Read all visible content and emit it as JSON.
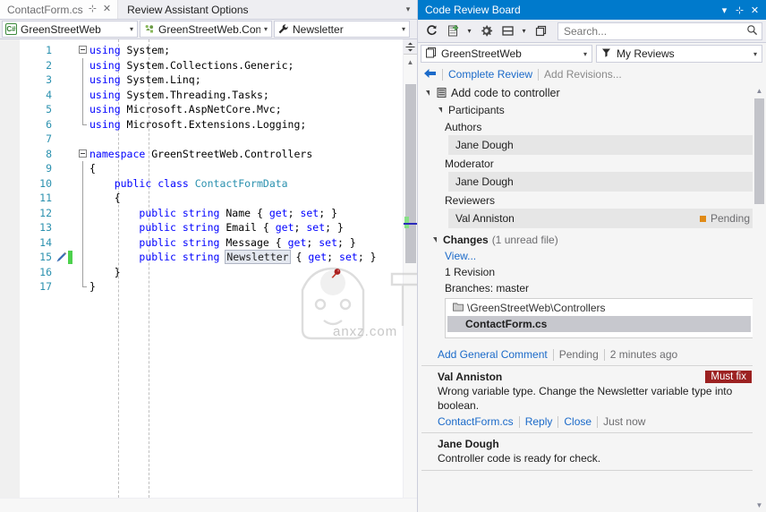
{
  "editor": {
    "tabs": [
      {
        "label": "ContactForm.cs",
        "active": true,
        "pin": "⊹",
        "close": "✕"
      },
      {
        "label": "Review Assistant Options",
        "active": false
      }
    ],
    "tab_overflow_icon": "chevron-down-icon",
    "nav": {
      "project": "GreenStreetWeb",
      "project_icon": "csharp-file-icon",
      "type": "GreenStreetWeb.Contro",
      "type_icon": "namespace-icon",
      "member": "Newsletter",
      "member_icon": "wrench-icon",
      "arrow": "▾"
    },
    "line_numbers": [
      "1",
      "2",
      "3",
      "4",
      "5",
      "6",
      "7",
      "8",
      "9",
      "10",
      "11",
      "12",
      "13",
      "14",
      "15",
      "16",
      "17"
    ],
    "code": [
      {
        "n": 1,
        "tokens": [
          {
            "t": "using",
            "c": "kw"
          },
          {
            "t": " System;",
            "c": "pn"
          }
        ]
      },
      {
        "n": 2,
        "tokens": [
          {
            "t": "using",
            "c": "kw"
          },
          {
            "t": " System.Collections.Generic;",
            "c": "pn"
          }
        ]
      },
      {
        "n": 3,
        "tokens": [
          {
            "t": "using",
            "c": "kw"
          },
          {
            "t": " System.Linq;",
            "c": "pn"
          }
        ]
      },
      {
        "n": 4,
        "tokens": [
          {
            "t": "using",
            "c": "kw"
          },
          {
            "t": " System.Threading.Tasks;",
            "c": "pn"
          }
        ]
      },
      {
        "n": 5,
        "tokens": [
          {
            "t": "using",
            "c": "kw"
          },
          {
            "t": " Microsoft.AspNetCore.Mvc;",
            "c": "pn"
          }
        ]
      },
      {
        "n": 6,
        "tokens": [
          {
            "t": "using",
            "c": "kw"
          },
          {
            "t": " Microsoft.Extensions.Logging;",
            "c": "pn"
          }
        ]
      },
      {
        "n": 7,
        "tokens": []
      },
      {
        "n": 8,
        "tokens": [
          {
            "t": "namespace",
            "c": "kw"
          },
          {
            "t": " GreenStreetWeb.Controllers",
            "c": "pn"
          }
        ]
      },
      {
        "n": 9,
        "tokens": [
          {
            "t": "{",
            "c": "pn"
          }
        ]
      },
      {
        "n": 10,
        "tokens": [
          {
            "t": "    ",
            "c": "pn"
          },
          {
            "t": "public",
            "c": "kw"
          },
          {
            "t": " ",
            "c": "pn"
          },
          {
            "t": "class",
            "c": "kw"
          },
          {
            "t": " ",
            "c": "pn"
          },
          {
            "t": "ContactFormData",
            "c": "ty"
          }
        ]
      },
      {
        "n": 11,
        "tokens": [
          {
            "t": "    {",
            "c": "pn"
          }
        ]
      },
      {
        "n": 12,
        "tokens": [
          {
            "t": "        ",
            "c": "pn"
          },
          {
            "t": "public",
            "c": "kw"
          },
          {
            "t": " ",
            "c": "pn"
          },
          {
            "t": "string",
            "c": "kw"
          },
          {
            "t": " Name { ",
            "c": "pn"
          },
          {
            "t": "get",
            "c": "kw"
          },
          {
            "t": "; ",
            "c": "pn"
          },
          {
            "t": "set",
            "c": "kw"
          },
          {
            "t": "; }",
            "c": "pn"
          }
        ]
      },
      {
        "n": 13,
        "tokens": [
          {
            "t": "        ",
            "c": "pn"
          },
          {
            "t": "public",
            "c": "kw"
          },
          {
            "t": " ",
            "c": "pn"
          },
          {
            "t": "string",
            "c": "kw"
          },
          {
            "t": " Email { ",
            "c": "pn"
          },
          {
            "t": "get",
            "c": "kw"
          },
          {
            "t": "; ",
            "c": "pn"
          },
          {
            "t": "set",
            "c": "kw"
          },
          {
            "t": "; }",
            "c": "pn"
          }
        ]
      },
      {
        "n": 14,
        "tokens": [
          {
            "t": "        ",
            "c": "pn"
          },
          {
            "t": "public",
            "c": "kw"
          },
          {
            "t": " ",
            "c": "pn"
          },
          {
            "t": "string",
            "c": "kw"
          },
          {
            "t": " Message { ",
            "c": "pn"
          },
          {
            "t": "get",
            "c": "kw"
          },
          {
            "t": "; ",
            "c": "pn"
          },
          {
            "t": "set",
            "c": "kw"
          },
          {
            "t": "; }",
            "c": "pn"
          }
        ]
      },
      {
        "n": 15,
        "tokens": [
          {
            "t": "        ",
            "c": "pn"
          },
          {
            "t": "public",
            "c": "kw"
          },
          {
            "t": " ",
            "c": "pn"
          },
          {
            "t": "string",
            "c": "kw"
          },
          {
            "t": " ",
            "c": "pn"
          },
          {
            "t": "Newsletter",
            "c": "sel"
          },
          {
            "t": " { ",
            "c": "pn"
          },
          {
            "t": "get",
            "c": "kw"
          },
          {
            "t": "; ",
            "c": "pn"
          },
          {
            "t": "set",
            "c": "kw"
          },
          {
            "t": "; }",
            "c": "pn"
          }
        ]
      },
      {
        "n": 16,
        "tokens": [
          {
            "t": "    }",
            "c": "pn"
          }
        ]
      },
      {
        "n": 17,
        "tokens": [
          {
            "t": "}",
            "c": "pn"
          }
        ]
      }
    ],
    "marker_line": 15,
    "marker_icon": "review-pin-icon",
    "change_bar_color": "#4dd14d",
    "watermark_text": "anxz.com"
  },
  "panel": {
    "title": "Code Review Board",
    "title_bg": "#007acc",
    "window_buttons": {
      "menu": "▾",
      "pin": "⊹",
      "close": "✕"
    },
    "toolbar": {
      "refresh": "refresh-icon",
      "new_review": "new-review-icon",
      "new_review_arrow": "▾",
      "settings": "gear-icon",
      "layout": "layout-icon",
      "layout_arrow": "▾",
      "windows": "windows-icon",
      "search_placeholder": "Search...",
      "search_value": "",
      "search_icon": "search-icon"
    },
    "filters": {
      "project": "GreenStreetWeb",
      "project_icon": "solution-icon",
      "scope": "My Reviews",
      "scope_icon": "filter-icon",
      "arrow": "▾"
    },
    "actions": {
      "back": "←",
      "complete_review": "Complete Review",
      "add_revisions": "Add Revisions..."
    },
    "review": {
      "title": "Add code to controller",
      "icon": "review-item-icon",
      "participants_label": "Participants",
      "groups": [
        {
          "label": "Authors",
          "people": [
            {
              "name": "Jane Dough",
              "status": ""
            }
          ]
        },
        {
          "label": "Moderator",
          "people": [
            {
              "name": "Jane Dough",
              "status": ""
            }
          ]
        },
        {
          "label": "Reviewers",
          "people": [
            {
              "name": "Val Anniston",
              "status": "Pending",
              "status_color": "#e08a16"
            }
          ]
        }
      ],
      "changes": {
        "label": "Changes",
        "sub": "(1 unread file)",
        "view_link": "View...",
        "revision": "1 Revision",
        "branches": "Branches:  master",
        "folder": "\\GreenStreetWeb\\Controllers",
        "folder_icon": "folder-icon",
        "file": "ContactForm.cs"
      }
    },
    "general_comment": {
      "add_link": "Add General Comment",
      "status": "Pending",
      "time": "2 minutes ago"
    },
    "comments": [
      {
        "author": "Val Anniston",
        "badge": "Must fix",
        "badge_color": "#9c2121",
        "text": "Wrong variable type. Change the Newsletter variable type into boolean.",
        "file_link": "ContactForm.cs",
        "reply_link": "Reply",
        "close_link": "Close",
        "time": "Just now"
      },
      {
        "author": "Jane Dough",
        "badge": "",
        "text": "Controller code is ready for check.",
        "file_link": "",
        "reply_link": "",
        "close_link": "",
        "time": ""
      }
    ]
  }
}
